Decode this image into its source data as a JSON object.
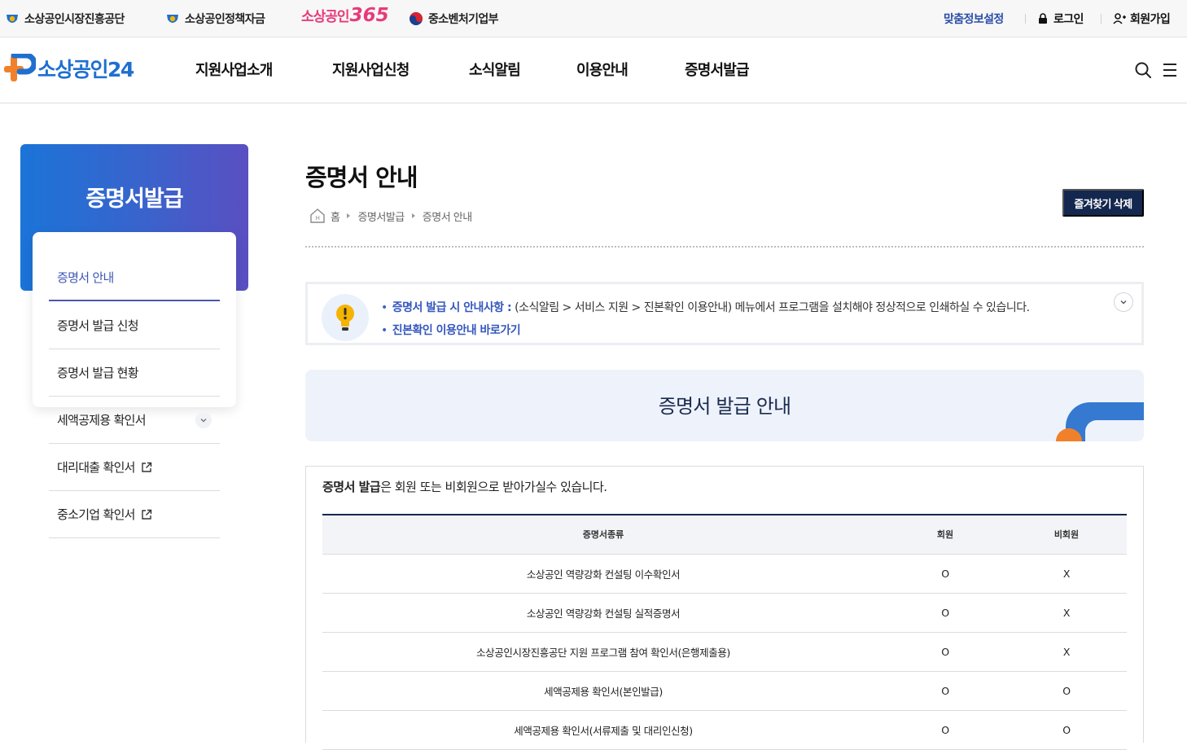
{
  "utility_bar": {
    "links": [
      {
        "label": "소상공인시장진흥공단",
        "icon": "semas-logo-icon"
      },
      {
        "label": "소상공인정책자금",
        "icon": "semas-logo-icon"
      },
      {
        "label": "중소벤처기업부",
        "icon": "taegeuk-icon"
      }
    ],
    "brand365": {
      "text": "소상공인",
      "number": "365"
    },
    "right": [
      {
        "label": "맞춤정보설정",
        "color": "#2a4ea8"
      },
      {
        "label": "로그인",
        "icon": "lock-icon"
      },
      {
        "label": "회원가입",
        "icon": "user-add-icon"
      }
    ]
  },
  "header": {
    "logo_text": "소상공인24",
    "nav": [
      "지원사업소개",
      "지원사업신청",
      "소식알림",
      "이용안내",
      "증명서발급"
    ],
    "icons": [
      "search-icon",
      "menu-icon"
    ]
  },
  "sidebar": {
    "title": "증명서발급",
    "items": [
      {
        "label": "증명서 안내",
        "active": true
      },
      {
        "label": "증명서 발급 신청"
      },
      {
        "label": "증명서 발급 현황"
      },
      {
        "label": "세액공제용 확인서",
        "icon": "chevron-down-icon"
      },
      {
        "label": "대리대출 확인서",
        "icon": "external-link-icon"
      },
      {
        "label": "중소기업 확인서",
        "icon": "external-link-icon"
      }
    ]
  },
  "content": {
    "title": "증명서 안내",
    "breadcrumb": [
      "홈",
      "증명서발급",
      "증명서 안내"
    ],
    "favorite_button": "즐겨찾기 삭제",
    "notice": {
      "line1_highlight": "증명서 발급 시 안내사항 :",
      "line1_text": "(소식알림 > 서비스 지원 > 진본확인 이용안내) 메뉴에서 프로그램을 설치해야 정상적으로 인쇄하실 수 있습니다.",
      "line2_link": "진본확인 이용안내 바로가기"
    },
    "banner_title": "증명서 발급 안내",
    "intro_bold": "증명서 발급",
    "intro_rest": "은 회원 또는 비회원으로 받아가실수 있습니다.",
    "table": {
      "headers": [
        "증명서종류",
        "회원",
        "비회원"
      ],
      "rows": [
        [
          "소상공인 역량강화 컨설팅 이수확인서",
          "O",
          "X"
        ],
        [
          "소상공인 역량강화 컨설팅 실적증명서",
          "O",
          "X"
        ],
        [
          "소상공인시장진흥공단 지원 프로그램 참여 확인서(은행제출용)",
          "O",
          "X"
        ],
        [
          "세액공제용 확인서(본인발급)",
          "O",
          "O"
        ],
        [
          "세액공제용 확인서(서류제출 및 대리인신청)",
          "O",
          "O"
        ]
      ]
    }
  },
  "colors": {
    "brand_blue": "#1f6fd0",
    "navy": "#14274e",
    "accent_orange": "#f0812a",
    "pink365": "#e83a78"
  }
}
